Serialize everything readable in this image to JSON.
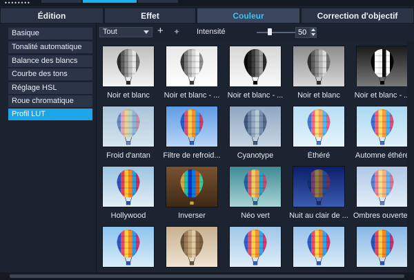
{
  "tabs": [
    {
      "label": "Édition",
      "active": false
    },
    {
      "label": "Effet",
      "active": false
    },
    {
      "label": "Couleur",
      "active": true
    },
    {
      "label": "Correction d'objectif",
      "active": false
    }
  ],
  "sidebar": {
    "items": [
      {
        "label": "Basique",
        "active": false
      },
      {
        "label": "Tonalité automatique",
        "active": false
      },
      {
        "label": "Balance des blancs",
        "active": false
      },
      {
        "label": "Courbe des tons",
        "active": false
      },
      {
        "label": "Réglage HSL",
        "active": false
      },
      {
        "label": "Roue chromatique",
        "active": false
      },
      {
        "label": "Profil LUT",
        "active": true
      }
    ]
  },
  "toolbar": {
    "filter_value": "Tout",
    "add_icon": "plus-icon",
    "favorite_icon": "star-icon",
    "intensity_label": "Intensité",
    "intensity_value": "50",
    "intensity_slider_level": 0.5
  },
  "presets": [
    {
      "label": "Noir et blanc",
      "style": "bw"
    },
    {
      "label": "Noir et blanc - ...",
      "style": "bw_high"
    },
    {
      "label": "Noir et blanc - ...",
      "style": "bw_dark"
    },
    {
      "label": "Noir et blanc",
      "style": "bw_mid"
    },
    {
      "label": "Noir et blanc - ...",
      "style": "bw_contrast"
    },
    {
      "label": "Froid d'antan",
      "style": "cold_old"
    },
    {
      "label": "Filtre de refroid...",
      "style": "cool_filter"
    },
    {
      "label": "Cyanotype",
      "style": "cyanotype"
    },
    {
      "label": "Éthéré",
      "style": "ethereal"
    },
    {
      "label": "Automne éthéré",
      "style": "autumn"
    },
    {
      "label": "Hollywood",
      "style": "hollywood"
    },
    {
      "label": "Inverser",
      "style": "invert"
    },
    {
      "label": "Néo vert",
      "style": "neo_green"
    },
    {
      "label": "Nuit au clair de ...",
      "style": "night"
    },
    {
      "label": "Ombres ouvertes",
      "style": "open_shadows"
    },
    {
      "label": "",
      "style": "normal"
    },
    {
      "label": "",
      "style": "sepia"
    },
    {
      "label": "",
      "style": "normal2"
    },
    {
      "label": "",
      "style": "normal3"
    },
    {
      "label": "",
      "style": "normal4"
    }
  ],
  "colors": {
    "accent": "#1da5ea",
    "active_tab_text": "#3fc0ff",
    "background": "#1b2230"
  }
}
